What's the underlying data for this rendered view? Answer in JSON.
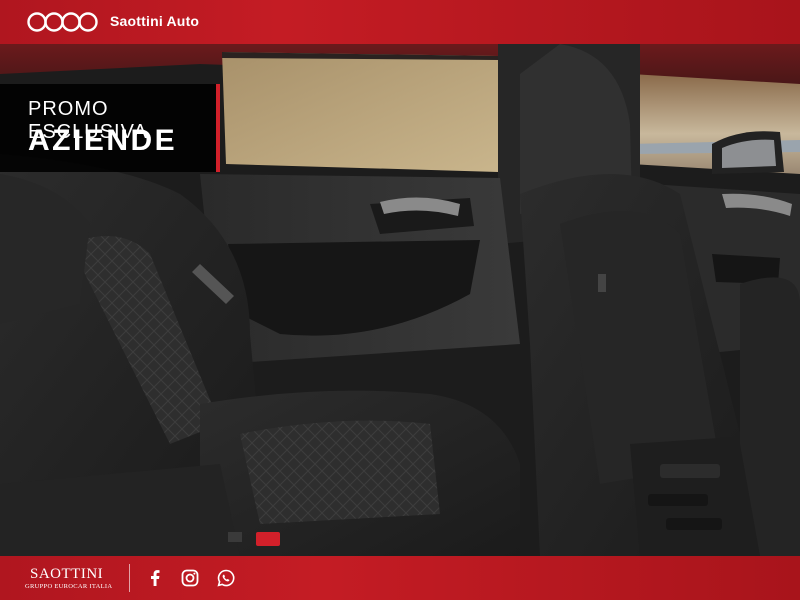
{
  "header": {
    "brand_name": "Saottini Auto",
    "logo_icon": "four-rings-logo"
  },
  "promo": {
    "line1": "PROMO ESCLUSIVA",
    "line2": "AZIENDE"
  },
  "footer": {
    "wordmark": "SAOTTINI",
    "subtitle": "GRUPPO EUROCAR ITALIA",
    "social_icons": [
      "facebook-icon",
      "instagram-icon",
      "whatsapp-icon"
    ]
  },
  "colors": {
    "brand_red": "#c41c24",
    "accent_red": "#d2202a",
    "badge_bg": "#000000"
  }
}
